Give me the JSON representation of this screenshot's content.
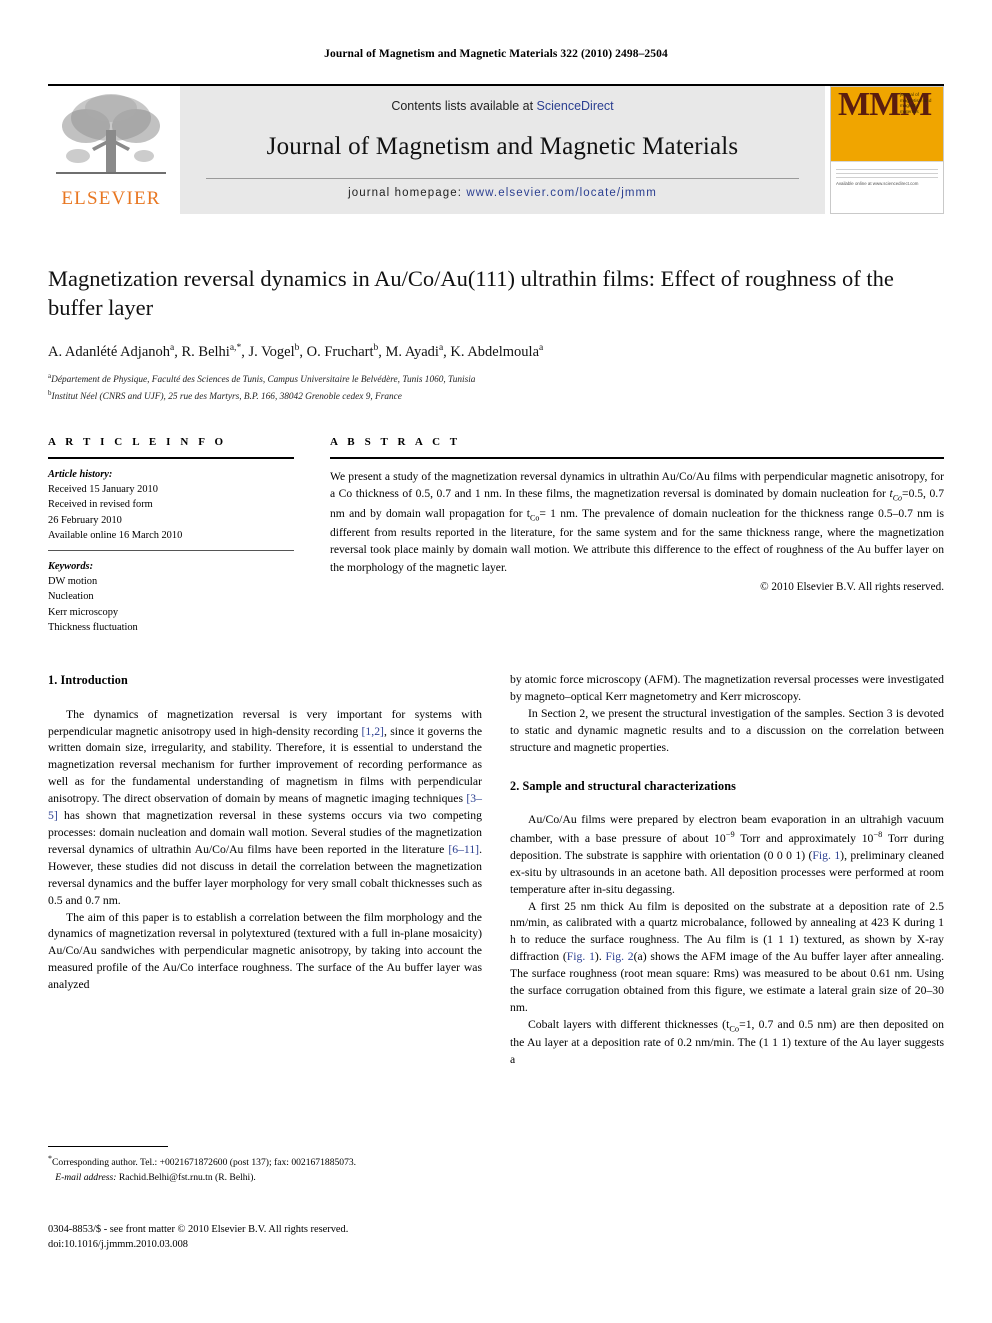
{
  "running_head": "Journal of Magnetism and Magnetic Materials 322 (2010) 2498–2504",
  "masthead": {
    "contents_prefix": "Contents lists available at ",
    "sciencedirect": "ScienceDirect",
    "journal_title": "Journal of Magnetism and Magnetic Materials",
    "homepage_prefix": "journal homepage: ",
    "homepage_url": "www.elsevier.com/locate/jmmm",
    "publisher_wordmark": "ELSEVIER",
    "publisher_color": "#e87722",
    "cover_monogram": "MMM",
    "cover_title_lines": "journal of magnetism and magnetic materials",
    "cover_footer": "Available online at www.sciencedirect.com",
    "cover_accent": "#f0a500"
  },
  "article": {
    "title": "Magnetization reversal dynamics in Au/Co/Au(111) ultrathin films: Effect of roughness of the buffer layer",
    "authors": "A. Adanlété Adjanoh a, R. Belhi a,*, J. Vogel b, O. Fruchart b, M. Ayadi a, K. Abdelmoula a",
    "affiliation_a": "Département de Physique, Faculté des Sciences de Tunis, Campus Universitaire le Belvédère, Tunis 1060, Tunisia",
    "affiliation_b": "Institut Néel (CNRS and UJF), 25 rue des Martyrs, B.P. 166, 38042 Grenoble cedex 9, France"
  },
  "article_info": {
    "heading": "A R T I C L E  I N F O",
    "history_label": "Article history:",
    "history": [
      "Received 15 January 2010",
      "Received in revised form",
      "26 February 2010",
      "Available online 16 March 2010"
    ],
    "keywords_label": "Keywords:",
    "keywords": [
      "DW motion",
      "Nucleation",
      "Kerr microscopy",
      "Thickness fluctuation"
    ]
  },
  "abstract": {
    "heading": "A B S T R A C T",
    "part1": "We present a study of the magnetization reversal dynamics in ultrathin Au/Co/Au films with perpendicular magnetic anisotropy, for a Co thickness of 0.5, 0.7 and 1 nm. In these films, the magnetization reversal is dominated by domain nucleation for ",
    "sub1_base": "t",
    "sub1_sub": "Co",
    "part2": "=0.5, 0.7 nm and by domain wall propagation for t",
    "sub2_sub": "Co",
    "part3": "= 1 nm. The prevalence of domain nucleation for the thickness range 0.5–0.7 nm is different from results reported in the literature, for the same system and for the same thickness range, where the magnetization reversal took place mainly by domain wall motion. We attribute this difference to the effect of roughness of the Au buffer layer on the morphology of the magnetic layer.",
    "copyright": "© 2010 Elsevier B.V. All rights reserved."
  },
  "sections": {
    "intro_heading": "1.  Introduction",
    "intro_p1_a": "The dynamics of magnetization reversal is very important for systems with perpendicular magnetic anisotropy used in high-density recording ",
    "intro_p1_ref1": "[1,2]",
    "intro_p1_b": ", since it governs the written domain size, irregularity, and stability. Therefore, it is essential to understand the magnetization reversal mechanism for further improvement of recording performance as well as for the fundamental understanding of magnetism in films with perpendicular anisotropy. The direct observation of domain by means of magnetic imaging techniques ",
    "intro_p1_ref2": "[3–5]",
    "intro_p1_c": " has shown that magnetization reversal in these systems occurs via two competing processes: domain nucleation and domain wall motion. Several studies of the magnetization reversal dynamics of ultrathin Au/Co/Au films have been reported in the literature ",
    "intro_p1_ref3": "[6–11]",
    "intro_p1_d": ". However, these studies did not discuss in detail the correlation between the magnetization reversal dynamics and the buffer layer morphology for very small cobalt thicknesses such as 0.5 and 0.7 nm.",
    "intro_p2": "The aim of this paper is to establish a correlation between the film morphology and the dynamics of magnetization reversal in polytextured (textured with a full in-plane mosaicity) Au/Co/Au sandwiches with perpendicular magnetic anisotropy, by taking into account the measured profile of the Au/Co interface roughness. The surface of the Au buffer layer was analyzed",
    "right_p1": "by atomic force microscopy (AFM). The magnetization reversal processes were investigated by magneto–optical Kerr magnetometry and Kerr microscopy.",
    "right_p2": "In Section 2, we present the structural investigation of the samples. Section 3 is devoted to static and dynamic magnetic results and to a discussion on the correlation between structure and magnetic properties.",
    "sec2_heading": "2.  Sample and structural characterizations",
    "sec2_p1_a": "Au/Co/Au films were prepared by electron beam evaporation in an ultrahigh vacuum chamber, with a base pressure of about 10",
    "sec2_p1_sup1": "−9",
    "sec2_p1_b": " Torr and approximately 10",
    "sec2_p1_sup2": "−8",
    "sec2_p1_c": " Torr during deposition. The substrate is sapphire with orientation (0 0 0 1) (",
    "sec2_p1_fig1": "Fig. 1",
    "sec2_p1_d": "), preliminary cleaned ex-situ by ultrasounds in an acetone bath. All deposition processes were performed at room temperature after in-situ degassing.",
    "sec2_p2_a": "A first 25 nm thick Au film is deposited on the substrate at a deposition rate of 2.5 nm/min, as calibrated with a quartz microbalance, followed by annealing at 423 K during 1 h to reduce the surface roughness. The Au film is (1 1 1) textured, as shown by X-ray diffraction (",
    "sec2_p2_fig1": "Fig. 1",
    "sec2_p2_b": "). ",
    "sec2_p2_fig2": "Fig. 2",
    "sec2_p2_c": "(a) shows the AFM image of the Au buffer layer after annealing. The surface roughness (root mean square: Rms) was measured to be about 0.61 nm. Using the surface corrugation obtained from this figure, we estimate a lateral grain size of 20–30 nm.",
    "sec2_p3_a": "Cobalt layers with different thicknesses (t",
    "sec2_p3_sub": "Co",
    "sec2_p3_b": "=1, 0.7 and 0.5 nm) are then deposited on the Au layer at a deposition rate of 0.2 nm/min. The (1 1 1) texture of the Au layer suggests a"
  },
  "footnotes": {
    "corresponding": "Corresponding author. Tel.: +0021671872600 (post 137); fax: 0021671885073.",
    "email_label": "E-mail address:",
    "email_value": "Rachid.Belhi@fst.rnu.tn (R. Belhi).",
    "imprint_line1": "0304-8853/$ - see front matter © 2010 Elsevier B.V. All rights reserved.",
    "imprint_line2": "doi:10.1016/j.jmmm.2010.03.008"
  }
}
